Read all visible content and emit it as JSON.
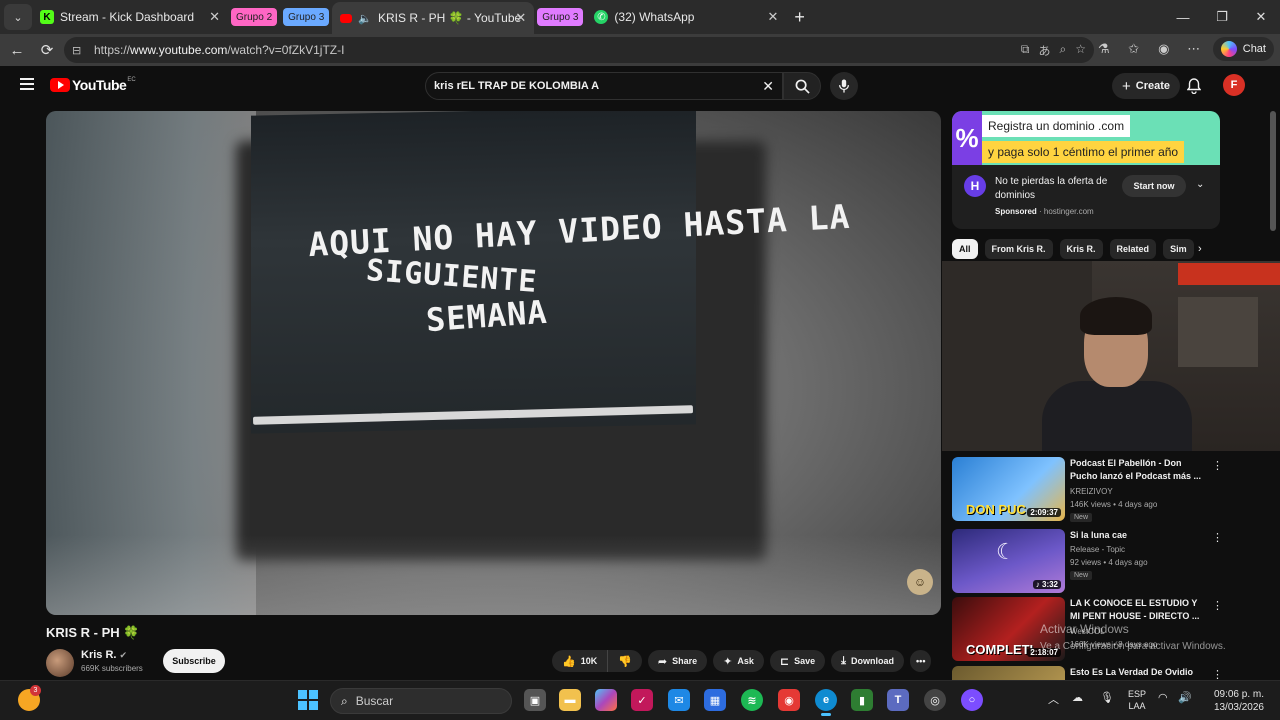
{
  "browser": {
    "tabs": [
      {
        "title": "Stream - Kick Dashboard",
        "icon": "kick-icon"
      },
      {
        "title": "KRIS R - PH 🍀 - YouTube",
        "icon": "youtube-icon",
        "active": true
      },
      {
        "title": "(32) WhatsApp",
        "icon": "whatsapp-icon"
      }
    ],
    "groups": [
      "Grupo 2",
      "Grupo 3",
      "Grupo 3"
    ],
    "new_tab": "+",
    "url_prefix": "https://",
    "url_host": "www.youtube.com",
    "url_path": "/watch?v=0fZkV1jTZ-I",
    "chat_label": "Chat"
  },
  "youtube": {
    "logo": "YouTube",
    "country": "EC",
    "search_value": "kris rEL TRAP DE KOLOMBIA A",
    "create_label": "Create",
    "avatar_letter": "F",
    "video": {
      "overlay_lines": [
        "AQUI NO HAY VIDEO HASTA LA",
        "SIGUIENTE",
        "SEMANA"
      ],
      "title": "KRIS R - PH 🍀",
      "channel": "Kris R.",
      "subscribers": "669K subscribers",
      "subscribe_label": "Subscribe",
      "likes": "10K",
      "share_label": "Share",
      "ask_label": "Ask",
      "save_label": "Save",
      "download_label": "Download",
      "more_label": "•••"
    },
    "ad": {
      "banner_line1": "Registra un dominio .com",
      "banner_line2": "y paga solo 1 céntimo el primer año",
      "text": "No te pierdas la oferta de dominios",
      "sponsored": "Sponsored",
      "domain": " · hostinger.com",
      "cta": "Start now"
    },
    "chips": [
      "All",
      "From Kris R.",
      "Kris R.",
      "Related",
      "Sim"
    ],
    "recommendations": [
      {
        "title": "Podcast El Pabellón - Don Pucho lanzó el Podcast más ...",
        "channel": "KREIZIVOY",
        "meta": "146K views • 4 days ago",
        "badge": "New",
        "duration": "2:09:37",
        "thumb_text": "DON PUC"
      },
      {
        "title": "Si la luna cae",
        "channel": "Release - Topic",
        "meta": "92 views • 4 days ago",
        "badge": "New",
        "duration": "♪ 3:32",
        "thumb_text": ""
      },
      {
        "title": "LA K CONOCE EL ESTUDIO Y MI PENT HOUSE - DIRECTO ...",
        "channel": "WestCOL",
        "meta": "166K views • 8 days ago",
        "badge": "",
        "duration": "2:18:07",
        "thumb_text": "COMPLETI"
      },
      {
        "title": "Esto Es La Verdad De Ovidio",
        "channel": "",
        "meta": "",
        "badge": "",
        "duration": "",
        "thumb_text": ""
      }
    ],
    "windows_watermark": [
      "Activar Windows",
      "Ve a Configuración para activar Windows."
    ]
  },
  "taskbar": {
    "weather_badge": "3",
    "search_placeholder": "Buscar",
    "lang_line1": "ESP",
    "lang_line2": "LAA",
    "time": "09:06 p. m.",
    "date": "13/03/2026"
  }
}
